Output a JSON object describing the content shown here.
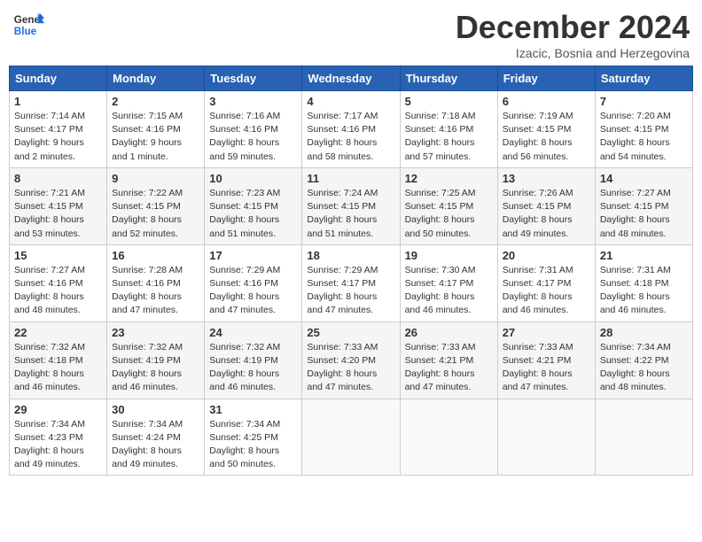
{
  "header": {
    "logo_line1": "General",
    "logo_line2": "Blue",
    "month_title": "December 2024",
    "subtitle": "Izacic, Bosnia and Herzegovina"
  },
  "days_of_week": [
    "Sunday",
    "Monday",
    "Tuesday",
    "Wednesday",
    "Thursday",
    "Friday",
    "Saturday"
  ],
  "weeks": [
    [
      {
        "day": "1",
        "info": "Sunrise: 7:14 AM\nSunset: 4:17 PM\nDaylight: 9 hours\nand 2 minutes."
      },
      {
        "day": "2",
        "info": "Sunrise: 7:15 AM\nSunset: 4:16 PM\nDaylight: 9 hours\nand 1 minute."
      },
      {
        "day": "3",
        "info": "Sunrise: 7:16 AM\nSunset: 4:16 PM\nDaylight: 8 hours\nand 59 minutes."
      },
      {
        "day": "4",
        "info": "Sunrise: 7:17 AM\nSunset: 4:16 PM\nDaylight: 8 hours\nand 58 minutes."
      },
      {
        "day": "5",
        "info": "Sunrise: 7:18 AM\nSunset: 4:16 PM\nDaylight: 8 hours\nand 57 minutes."
      },
      {
        "day": "6",
        "info": "Sunrise: 7:19 AM\nSunset: 4:15 PM\nDaylight: 8 hours\nand 56 minutes."
      },
      {
        "day": "7",
        "info": "Sunrise: 7:20 AM\nSunset: 4:15 PM\nDaylight: 8 hours\nand 54 minutes."
      }
    ],
    [
      {
        "day": "8",
        "info": "Sunrise: 7:21 AM\nSunset: 4:15 PM\nDaylight: 8 hours\nand 53 minutes."
      },
      {
        "day": "9",
        "info": "Sunrise: 7:22 AM\nSunset: 4:15 PM\nDaylight: 8 hours\nand 52 minutes."
      },
      {
        "day": "10",
        "info": "Sunrise: 7:23 AM\nSunset: 4:15 PM\nDaylight: 8 hours\nand 51 minutes."
      },
      {
        "day": "11",
        "info": "Sunrise: 7:24 AM\nSunset: 4:15 PM\nDaylight: 8 hours\nand 51 minutes."
      },
      {
        "day": "12",
        "info": "Sunrise: 7:25 AM\nSunset: 4:15 PM\nDaylight: 8 hours\nand 50 minutes."
      },
      {
        "day": "13",
        "info": "Sunrise: 7:26 AM\nSunset: 4:15 PM\nDaylight: 8 hours\nand 49 minutes."
      },
      {
        "day": "14",
        "info": "Sunrise: 7:27 AM\nSunset: 4:15 PM\nDaylight: 8 hours\nand 48 minutes."
      }
    ],
    [
      {
        "day": "15",
        "info": "Sunrise: 7:27 AM\nSunset: 4:16 PM\nDaylight: 8 hours\nand 48 minutes."
      },
      {
        "day": "16",
        "info": "Sunrise: 7:28 AM\nSunset: 4:16 PM\nDaylight: 8 hours\nand 47 minutes."
      },
      {
        "day": "17",
        "info": "Sunrise: 7:29 AM\nSunset: 4:16 PM\nDaylight: 8 hours\nand 47 minutes."
      },
      {
        "day": "18",
        "info": "Sunrise: 7:29 AM\nSunset: 4:17 PM\nDaylight: 8 hours\nand 47 minutes."
      },
      {
        "day": "19",
        "info": "Sunrise: 7:30 AM\nSunset: 4:17 PM\nDaylight: 8 hours\nand 46 minutes."
      },
      {
        "day": "20",
        "info": "Sunrise: 7:31 AM\nSunset: 4:17 PM\nDaylight: 8 hours\nand 46 minutes."
      },
      {
        "day": "21",
        "info": "Sunrise: 7:31 AM\nSunset: 4:18 PM\nDaylight: 8 hours\nand 46 minutes."
      }
    ],
    [
      {
        "day": "22",
        "info": "Sunrise: 7:32 AM\nSunset: 4:18 PM\nDaylight: 8 hours\nand 46 minutes."
      },
      {
        "day": "23",
        "info": "Sunrise: 7:32 AM\nSunset: 4:19 PM\nDaylight: 8 hours\nand 46 minutes."
      },
      {
        "day": "24",
        "info": "Sunrise: 7:32 AM\nSunset: 4:19 PM\nDaylight: 8 hours\nand 46 minutes."
      },
      {
        "day": "25",
        "info": "Sunrise: 7:33 AM\nSunset: 4:20 PM\nDaylight: 8 hours\nand 47 minutes."
      },
      {
        "day": "26",
        "info": "Sunrise: 7:33 AM\nSunset: 4:21 PM\nDaylight: 8 hours\nand 47 minutes."
      },
      {
        "day": "27",
        "info": "Sunrise: 7:33 AM\nSunset: 4:21 PM\nDaylight: 8 hours\nand 47 minutes."
      },
      {
        "day": "28",
        "info": "Sunrise: 7:34 AM\nSunset: 4:22 PM\nDaylight: 8 hours\nand 48 minutes."
      }
    ],
    [
      {
        "day": "29",
        "info": "Sunrise: 7:34 AM\nSunset: 4:23 PM\nDaylight: 8 hours\nand 49 minutes."
      },
      {
        "day": "30",
        "info": "Sunrise: 7:34 AM\nSunset: 4:24 PM\nDaylight: 8 hours\nand 49 minutes."
      },
      {
        "day": "31",
        "info": "Sunrise: 7:34 AM\nSunset: 4:25 PM\nDaylight: 8 hours\nand 50 minutes."
      },
      null,
      null,
      null,
      null
    ]
  ]
}
